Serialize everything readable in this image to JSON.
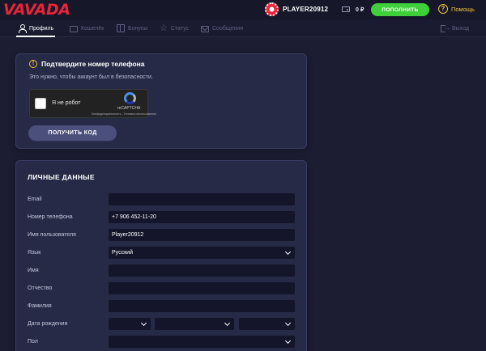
{
  "header": {
    "logo": "VAVADA",
    "username": "PLAYER20912",
    "balance": "0 ₽",
    "topup_label": "ПОПОЛНИТЬ",
    "help_label": "Помощь",
    "icons": [
      "avatar-chip-icon",
      "wallet-icon",
      "help-icon"
    ]
  },
  "tabs": [
    {
      "label": "Профиль",
      "icon": "user-icon",
      "active": true
    },
    {
      "label": "Кошелёк",
      "icon": "wallet-icon",
      "active": false
    },
    {
      "label": "Бонусы",
      "icon": "gift-icon",
      "active": false
    },
    {
      "label": "Статус",
      "icon": "star-icon",
      "active": false
    },
    {
      "label": "Сообщения",
      "icon": "mail-icon",
      "active": false
    }
  ],
  "logout_label": "Выход",
  "verify": {
    "title": "Подтвердите номер телефона",
    "subtitle": "Это нужно, чтобы аккаунт был в безопасности.",
    "captcha_label": "Я не робот",
    "captcha_brand": "reCAPTCHA",
    "captcha_links": "Конфиденциальность - Условия использования",
    "button_label": "ПОЛУЧИТЬ КОД"
  },
  "personal": {
    "title": "ЛИЧНЫЕ ДАННЫЕ",
    "fields": [
      {
        "label": "Email",
        "value": ""
      },
      {
        "label": "Номер телефона",
        "value": "+7 906 452-11-20"
      },
      {
        "label": "Имя пользователя",
        "value": "Player20912"
      },
      {
        "label": "Язык",
        "value": "Русский"
      },
      {
        "label": "Имя",
        "value": ""
      },
      {
        "label": "Отчество",
        "value": ""
      },
      {
        "label": "Фамилия",
        "value": ""
      },
      {
        "label": "Дата рождения",
        "value": ""
      },
      {
        "label": "Пол",
        "value": ""
      }
    ]
  },
  "colors": {
    "background": "#1c1d33",
    "card": "#272a46",
    "input": "#14152a",
    "brand_red": "#e8243a",
    "topup_green": "#3fcf3a",
    "help_yellow": "#f0c53a"
  }
}
